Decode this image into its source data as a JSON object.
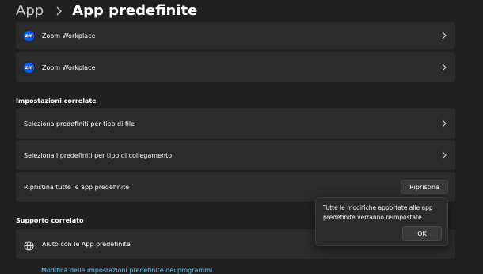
{
  "breadcrumb": {
    "root": "App",
    "current": "App predefinite"
  },
  "apps": [
    {
      "icon": "zoom-app-icon",
      "icon_text": "zm",
      "label": "Zoom Workplace"
    },
    {
      "icon": "zoom-app-icon",
      "icon_text": "zm",
      "label": "Zoom Workplace"
    }
  ],
  "related_settings": {
    "title": "Impostazioni correlate",
    "file_type": "Seleziona predefiniti per tipo di file",
    "link_type": "Seleziona i predefiniti per tipo di collegamento",
    "reset_label": "Ripristina tutte le app predefinite",
    "reset_button": "Ripristina"
  },
  "related_support": {
    "title": "Supporto correlato",
    "help_label": "Aiuto con le App predefinite",
    "help_icon": "globe-icon",
    "link": "Modifica delle impostazioni predefinite dei programmi"
  },
  "popup": {
    "message": "Tutte le modifiche apportate alle app predefinite verranno reimpostate.",
    "ok": "OK"
  },
  "colors": {
    "background": "#202020",
    "card": "#2b2b2b",
    "zoom_blue": "#0b5cff",
    "link": "#60cdff"
  }
}
